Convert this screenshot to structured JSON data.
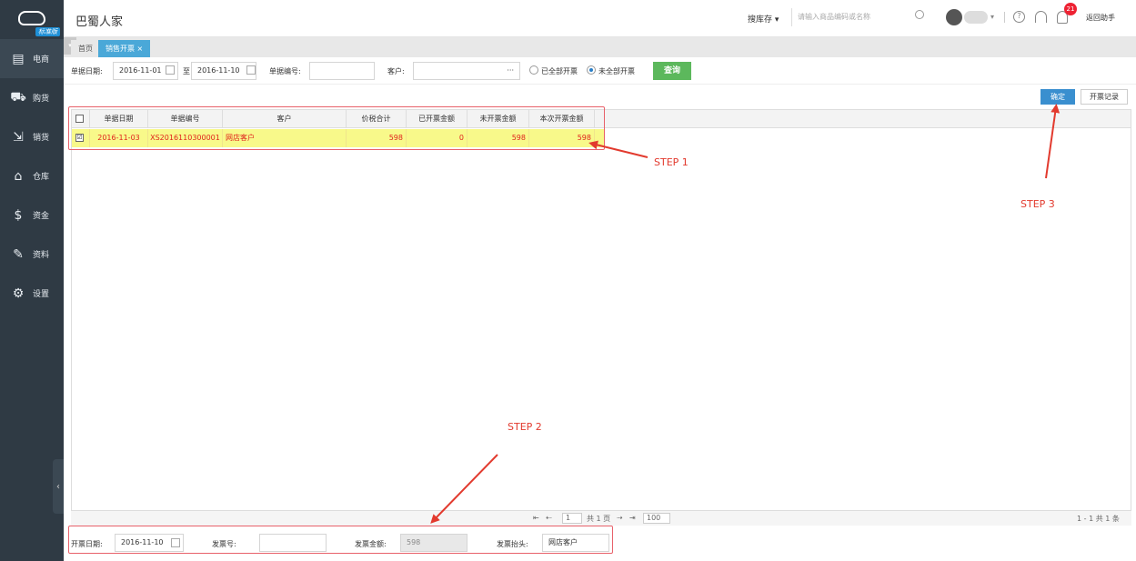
{
  "brand": {
    "badge": "标准版"
  },
  "sidebar": {
    "items": [
      {
        "label": "电商",
        "icon": "store-icon"
      },
      {
        "label": "购货",
        "icon": "cart-icon"
      },
      {
        "label": "销货",
        "icon": "sell-icon"
      },
      {
        "label": "仓库",
        "icon": "warehouse-icon"
      },
      {
        "label": "资金",
        "icon": "money-icon"
      },
      {
        "label": "资料",
        "icon": "pen-icon"
      },
      {
        "label": "设置",
        "icon": "gear-icon"
      }
    ]
  },
  "header": {
    "title": "巴蜀人家",
    "search_scope": "搜库存",
    "search_placeholder": "请输入商品编码或名称",
    "notification_count": "21",
    "helper": "返回助手"
  },
  "tabs": {
    "home": "首页",
    "active": "销售开票"
  },
  "filters": {
    "date_label": "单据日期:",
    "date_from": "2016-11-01",
    "date_to_label": "至",
    "date_to": "2016-11-10",
    "doc_no_label": "单据编号:",
    "customer_label": "客户:",
    "customer_more": "···",
    "radio_all": "已全部开票",
    "radio_none": "未全部开票",
    "query": "查询"
  },
  "actions": {
    "confirm": "确定",
    "records": "开票记录"
  },
  "grid": {
    "columns": [
      "单据日期",
      "单据编号",
      "客户",
      "价税合计",
      "已开票金额",
      "未开票金额",
      "本次开票金额"
    ],
    "rows": [
      {
        "checked": "☑",
        "date": "2016-11-03",
        "no": "XS2016110300001",
        "customer": "网店客户",
        "total": "598",
        "invoiced": "0",
        "uninvoiced": "598",
        "current": "598"
      }
    ]
  },
  "pager": {
    "page": "1",
    "total_pages": "共 1 页",
    "page_size": "100",
    "summary": "1 - 1  共 1 条"
  },
  "bottom_form": {
    "invoice_date_label": "开票日期:",
    "invoice_date": "2016-11-10",
    "invoice_no_label": "发票号:",
    "amount_label": "发票金额:",
    "amount": "598",
    "title_label": "发票抬头:",
    "title": "网店客户"
  },
  "annotations": {
    "step1": "STEP 1",
    "step2": "STEP 2",
    "step3": "STEP 3",
    "color": "#e23a2e"
  }
}
